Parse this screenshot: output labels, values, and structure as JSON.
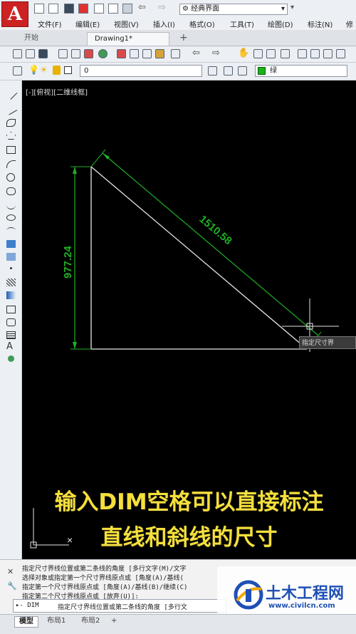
{
  "app": {
    "logo_letter": "A",
    "workspace": "经典界面"
  },
  "menu": [
    "文件(F)",
    "编辑(E)",
    "视图(V)",
    "插入(I)",
    "格式(O)",
    "工具(T)",
    "绘图(D)",
    "标注(N)",
    "修"
  ],
  "tabs": {
    "start": "开始",
    "drawing": "Drawing1*",
    "add": "+"
  },
  "layer": {
    "current": "0",
    "color_label": "绿",
    "color_hex": "#19b31a"
  },
  "canvas": {
    "viewport_label": "[-][俯视][二维线框]",
    "vertical_dimension": "977.24",
    "hypotenuse_dimension": "1510.58",
    "dimension_color": "#1fae25",
    "cursor_tooltip": "指定尺寸界",
    "caption_line1": "输入DIM空格可以直接标注",
    "caption_line2": "直线和斜线的尺寸"
  },
  "command": {
    "history": [
      "指定尺寸界线位置或第二条线的角度 [多行文字(M)/文字",
      "选择对象或指定第一个尺寸界线原点或 [角度(A)/基线(",
      "指定第一个尺寸界线原点或 [角度(A)/基线(B)/继续(C)",
      "指定第二个尺寸界线原点或 [放弃(U)]:"
    ],
    "prompt_prefix": "▸- DIM",
    "prompt": "指定尺寸界线位置或第二条线的角度 [多行文"
  },
  "layout_tabs": [
    "模型",
    "布局1",
    "布局2",
    "+"
  ],
  "watermark": {
    "title": "土木工程网",
    "url": "www.civilcn.com"
  }
}
